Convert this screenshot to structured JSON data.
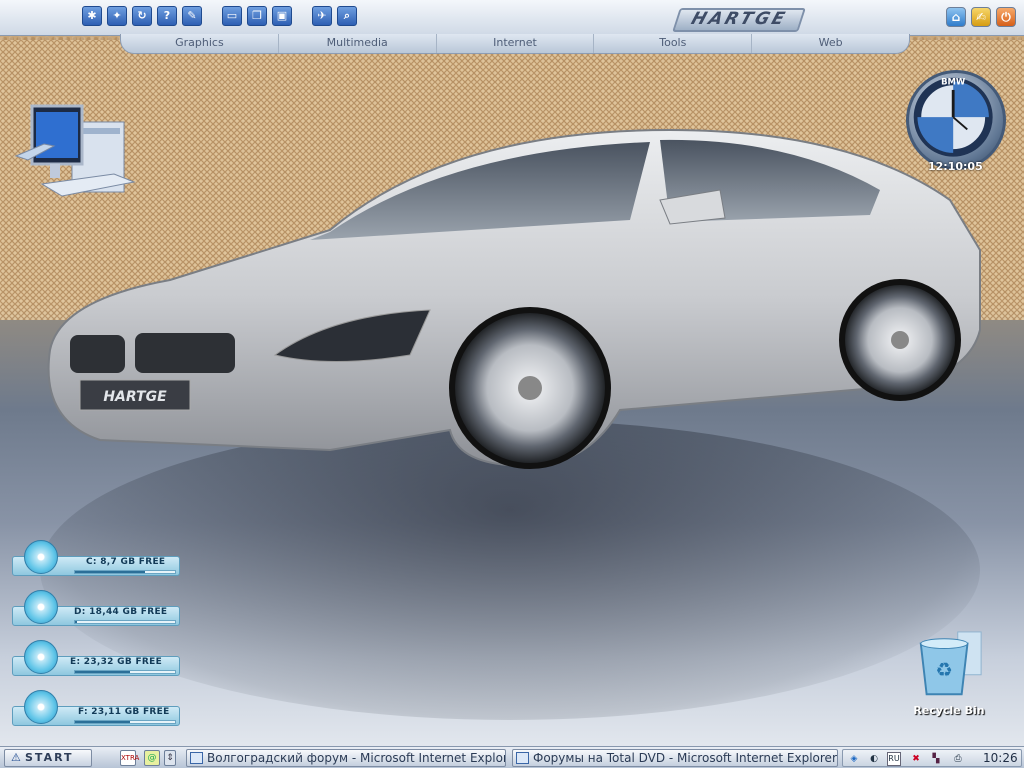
{
  "top_dock": {
    "logo_text": "HARTGE",
    "tabs": [
      "Graphics",
      "Multimedia",
      "Internet",
      "Tools",
      "Web"
    ],
    "buttons": [
      {
        "icon": "settings-icon",
        "glyph": "✱"
      },
      {
        "icon": "sparkle-icon",
        "glyph": "✦"
      },
      {
        "icon": "refresh-icon",
        "glyph": "↻"
      },
      {
        "icon": "help-icon",
        "glyph": "?"
      },
      {
        "icon": "pen-icon",
        "glyph": "✎"
      },
      {
        "icon": "window-icon",
        "glyph": "▭"
      },
      {
        "icon": "cascade-icon",
        "glyph": "❐"
      },
      {
        "icon": "monitor-icon",
        "glyph": "▣"
      },
      {
        "icon": "run-icon",
        "glyph": "✈"
      },
      {
        "icon": "search-icon",
        "glyph": "⌕"
      }
    ],
    "corner_buttons": [
      {
        "icon": "home-icon",
        "glyph": "⌂",
        "color": "#4d9de0"
      },
      {
        "icon": "key-icon",
        "glyph": "✍",
        "color": "#e3b32b"
      },
      {
        "icon": "power-icon",
        "glyph": "⏻",
        "color": "#e2782a"
      }
    ]
  },
  "clock_widget": {
    "brand": "BMW",
    "time": "12:10:05"
  },
  "drives": [
    {
      "label": "C: 8,7 GB FREE",
      "usage": 0.7
    },
    {
      "label": "D: 18,44 GB FREE",
      "usage": 0.02
    },
    {
      "label": "E: 23,32 GB FREE",
      "usage": 0.55
    },
    {
      "label": "F: 23,11 GB FREE",
      "usage": 0.55
    }
  ],
  "desktop_icons": {
    "recycle_bin": "Recycle Bin"
  },
  "car_badge": "HARTGE",
  "taskbar": {
    "start_label": "START",
    "quicklaunch": [
      "XTRA",
      "@",
      "⇕"
    ],
    "tasks": [
      "Волгоградский форум - Microsoft Internet Explorer",
      "Форумы на Total DVD - Microsoft Internet Explorer"
    ],
    "tray_lang": "RU",
    "clock": "10:26"
  }
}
